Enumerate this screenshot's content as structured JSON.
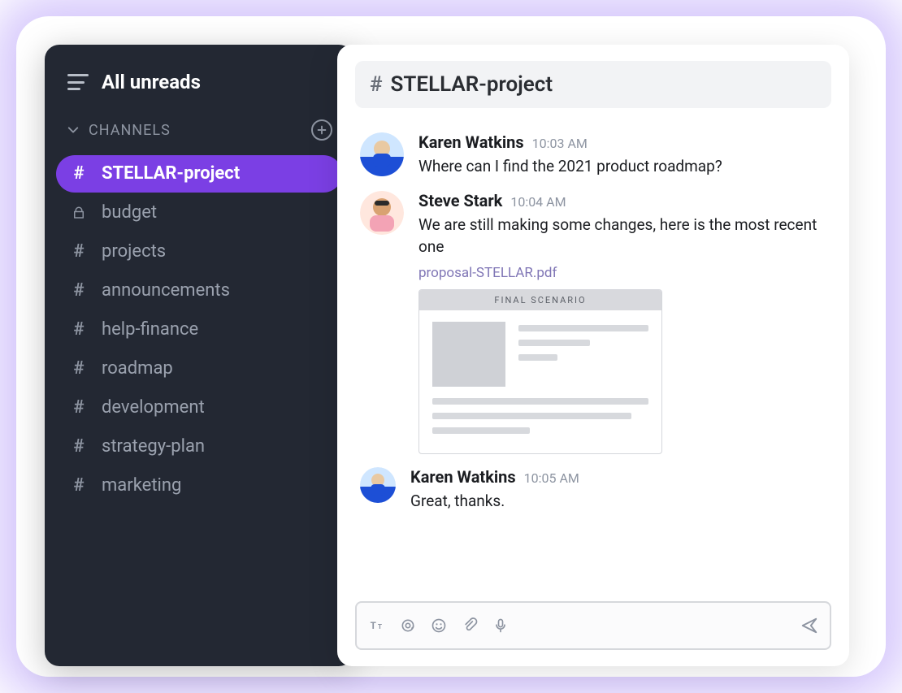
{
  "sidebar": {
    "title": "All unreads",
    "section_label": "CHANNELS",
    "channels": [
      {
        "name": "STELLAR-project",
        "active": true,
        "locked": false
      },
      {
        "name": "budget",
        "active": false,
        "locked": true
      },
      {
        "name": "projects",
        "active": false,
        "locked": false
      },
      {
        "name": "announcements",
        "active": false,
        "locked": false
      },
      {
        "name": "help-finance",
        "active": false,
        "locked": false
      },
      {
        "name": "roadmap",
        "active": false,
        "locked": false
      },
      {
        "name": "development",
        "active": false,
        "locked": false
      },
      {
        "name": "strategy-plan",
        "active": false,
        "locked": false
      },
      {
        "name": "marketing",
        "active": false,
        "locked": false
      }
    ]
  },
  "chat": {
    "room_name": "STELLAR-project",
    "messages": [
      {
        "author": "Karen Watkins",
        "time": "10:03 AM",
        "text": "Where can I find the 2021 product roadmap?"
      },
      {
        "author": "Steve Stark",
        "time": "10:04 AM",
        "text": "We are still making some changes, here is the most recent one",
        "attachment": {
          "filename": "proposal-STELLAR.pdf",
          "preview_title": "FINAL SCENARIO"
        }
      },
      {
        "author": "Karen Watkins",
        "time": "10:05 AM",
        "text": "Great, thanks."
      }
    ]
  },
  "colors": {
    "accent": "#7b3fe4",
    "sidebar_bg": "#232833"
  }
}
